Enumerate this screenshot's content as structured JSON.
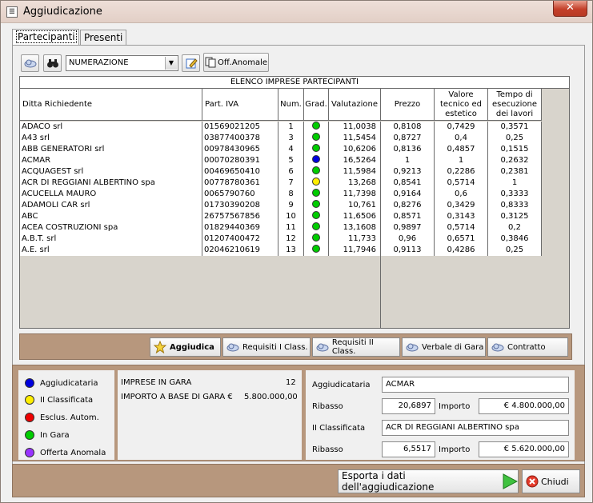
{
  "window": {
    "title": "Aggiudicazione",
    "close_glyph": "✕",
    "app_icon": "app-icon"
  },
  "tabs": [
    {
      "label": "Partecipanti",
      "active": true
    },
    {
      "label": "Presenti",
      "active": false
    }
  ],
  "toolbar": {
    "combo_value": "NUMERAZIONE",
    "off_anomale_label": "Off.Anomale"
  },
  "grid": {
    "title": "ELENCO IMPRESE PARTECIPANTI",
    "columns": [
      "Ditta Richiedente",
      "Part. IVA",
      "Num.",
      "Grad.",
      "Valutazione",
      "Prezzo",
      "Valore tecnico ed estetico",
      "Tempo di esecuzione dei lavori"
    ],
    "rows": [
      {
        "ditta": "ADACO srl",
        "piva": "01569021205",
        "num": "1",
        "grad": "green",
        "valutazione": "11,0038",
        "prezzo": "0,8108",
        "valore": "0,7429",
        "tempo": "0,3571"
      },
      {
        "ditta": "A43 srl",
        "piva": "03877400378",
        "num": "3",
        "grad": "green",
        "valutazione": "11,5454",
        "prezzo": "0,8727",
        "valore": "0,4",
        "tempo": "0,25"
      },
      {
        "ditta": "ABB GENERATORI srl",
        "piva": "00978430965",
        "num": "4",
        "grad": "green",
        "valutazione": "10,6206",
        "prezzo": "0,8136",
        "valore": "0,4857",
        "tempo": "0,1515"
      },
      {
        "ditta": "ACMAR",
        "piva": "00070280391",
        "num": "5",
        "grad": "blue",
        "valutazione": "16,5264",
        "prezzo": "1",
        "valore": "1",
        "tempo": "0,2632"
      },
      {
        "ditta": "ACQUAGEST srl",
        "piva": "00469650410",
        "num": "6",
        "grad": "green",
        "valutazione": "11,5984",
        "prezzo": "0,9213",
        "valore": "0,2286",
        "tempo": "0,2381"
      },
      {
        "ditta": "ACR DI REGGIANI ALBERTINO spa",
        "piva": "00778780361",
        "num": "7",
        "grad": "yellow",
        "valutazione": "13,268",
        "prezzo": "0,8541",
        "valore": "0,5714",
        "tempo": "1"
      },
      {
        "ditta": "ACUCELLA MAURO",
        "piva": "0065790760",
        "num": "8",
        "grad": "green",
        "valutazione": "11,7398",
        "prezzo": "0,9164",
        "valore": "0,6",
        "tempo": "0,3333"
      },
      {
        "ditta": "ADAMOLI CAR srl",
        "piva": "01730390208",
        "num": "9",
        "grad": "green",
        "valutazione": "10,761",
        "prezzo": "0,8276",
        "valore": "0,3429",
        "tempo": "0,8333"
      },
      {
        "ditta": "ABC",
        "piva": "26757567856",
        "num": "10",
        "grad": "green",
        "valutazione": "11,6506",
        "prezzo": "0,8571",
        "valore": "0,3143",
        "tempo": "0,3125"
      },
      {
        "ditta": "ACEA COSTRUZIONI spa",
        "piva": "01829440369",
        "num": "11",
        "grad": "green",
        "valutazione": "13,1608",
        "prezzo": "0,9897",
        "valore": "0,5714",
        "tempo": "0,2"
      },
      {
        "ditta": "A.B.T. srl",
        "piva": "01207400472",
        "num": "12",
        "grad": "green",
        "valutazione": "11,733",
        "prezzo": "0,96",
        "valore": "0,6571",
        "tempo": "0,3846"
      },
      {
        "ditta": "A.E. srl",
        "piva": "02046210619",
        "num": "13",
        "grad": "green",
        "valutazione": "11,7946",
        "prezzo": "0,9113",
        "valore": "0,4286",
        "tempo": "0,25"
      }
    ]
  },
  "actions": {
    "aggiudica": "Aggiudica",
    "requisiti_1": "Requisiti I Class.",
    "requisiti_2": "Requisiti II Class.",
    "verbale": "Verbale di Gara",
    "contratto": "Contratto"
  },
  "legend": [
    {
      "label": "Aggiudicataria",
      "color": "#0000dd"
    },
    {
      "label": "II Classificata",
      "color": "#ffee00"
    },
    {
      "label": "Esclus. Autom.",
      "color": "#ee0000"
    },
    {
      "label": "In Gara",
      "color": "#00cc00"
    },
    {
      "label": "Offerta Anomala",
      "color": "#9933ff"
    }
  ],
  "summary": {
    "imprese_label": "IMPRESE IN GARA",
    "imprese_value": "12",
    "importo_label": "IMPORTO A BASE DI GARA €",
    "importo_value": "5.800.000,00"
  },
  "result": {
    "aggiudicataria_label": "Aggiudicataria",
    "aggiudicataria_value": "ACMAR",
    "ribasso1_label": "Ribasso",
    "ribasso1_value": "20,6897",
    "importo1_label": "Importo",
    "importo1_value": "€ 4.800.000,00",
    "classificata_label": "II Classificata",
    "classificata_value": "ACR DI REGGIANI ALBERTINO spa",
    "ribasso2_label": "Ribasso",
    "ribasso2_value": "6,5517",
    "importo2_label": "Importo",
    "importo2_value": "€ 5.620.000,00"
  },
  "footer": {
    "esporta_label": "Esporta i dati dell'aggiudicazione",
    "chiudi_label": "Chiudi"
  },
  "colors": {
    "green": "#00cc00",
    "blue": "#0000dd",
    "yellow": "#ffee00",
    "frame": "#b7977d"
  }
}
